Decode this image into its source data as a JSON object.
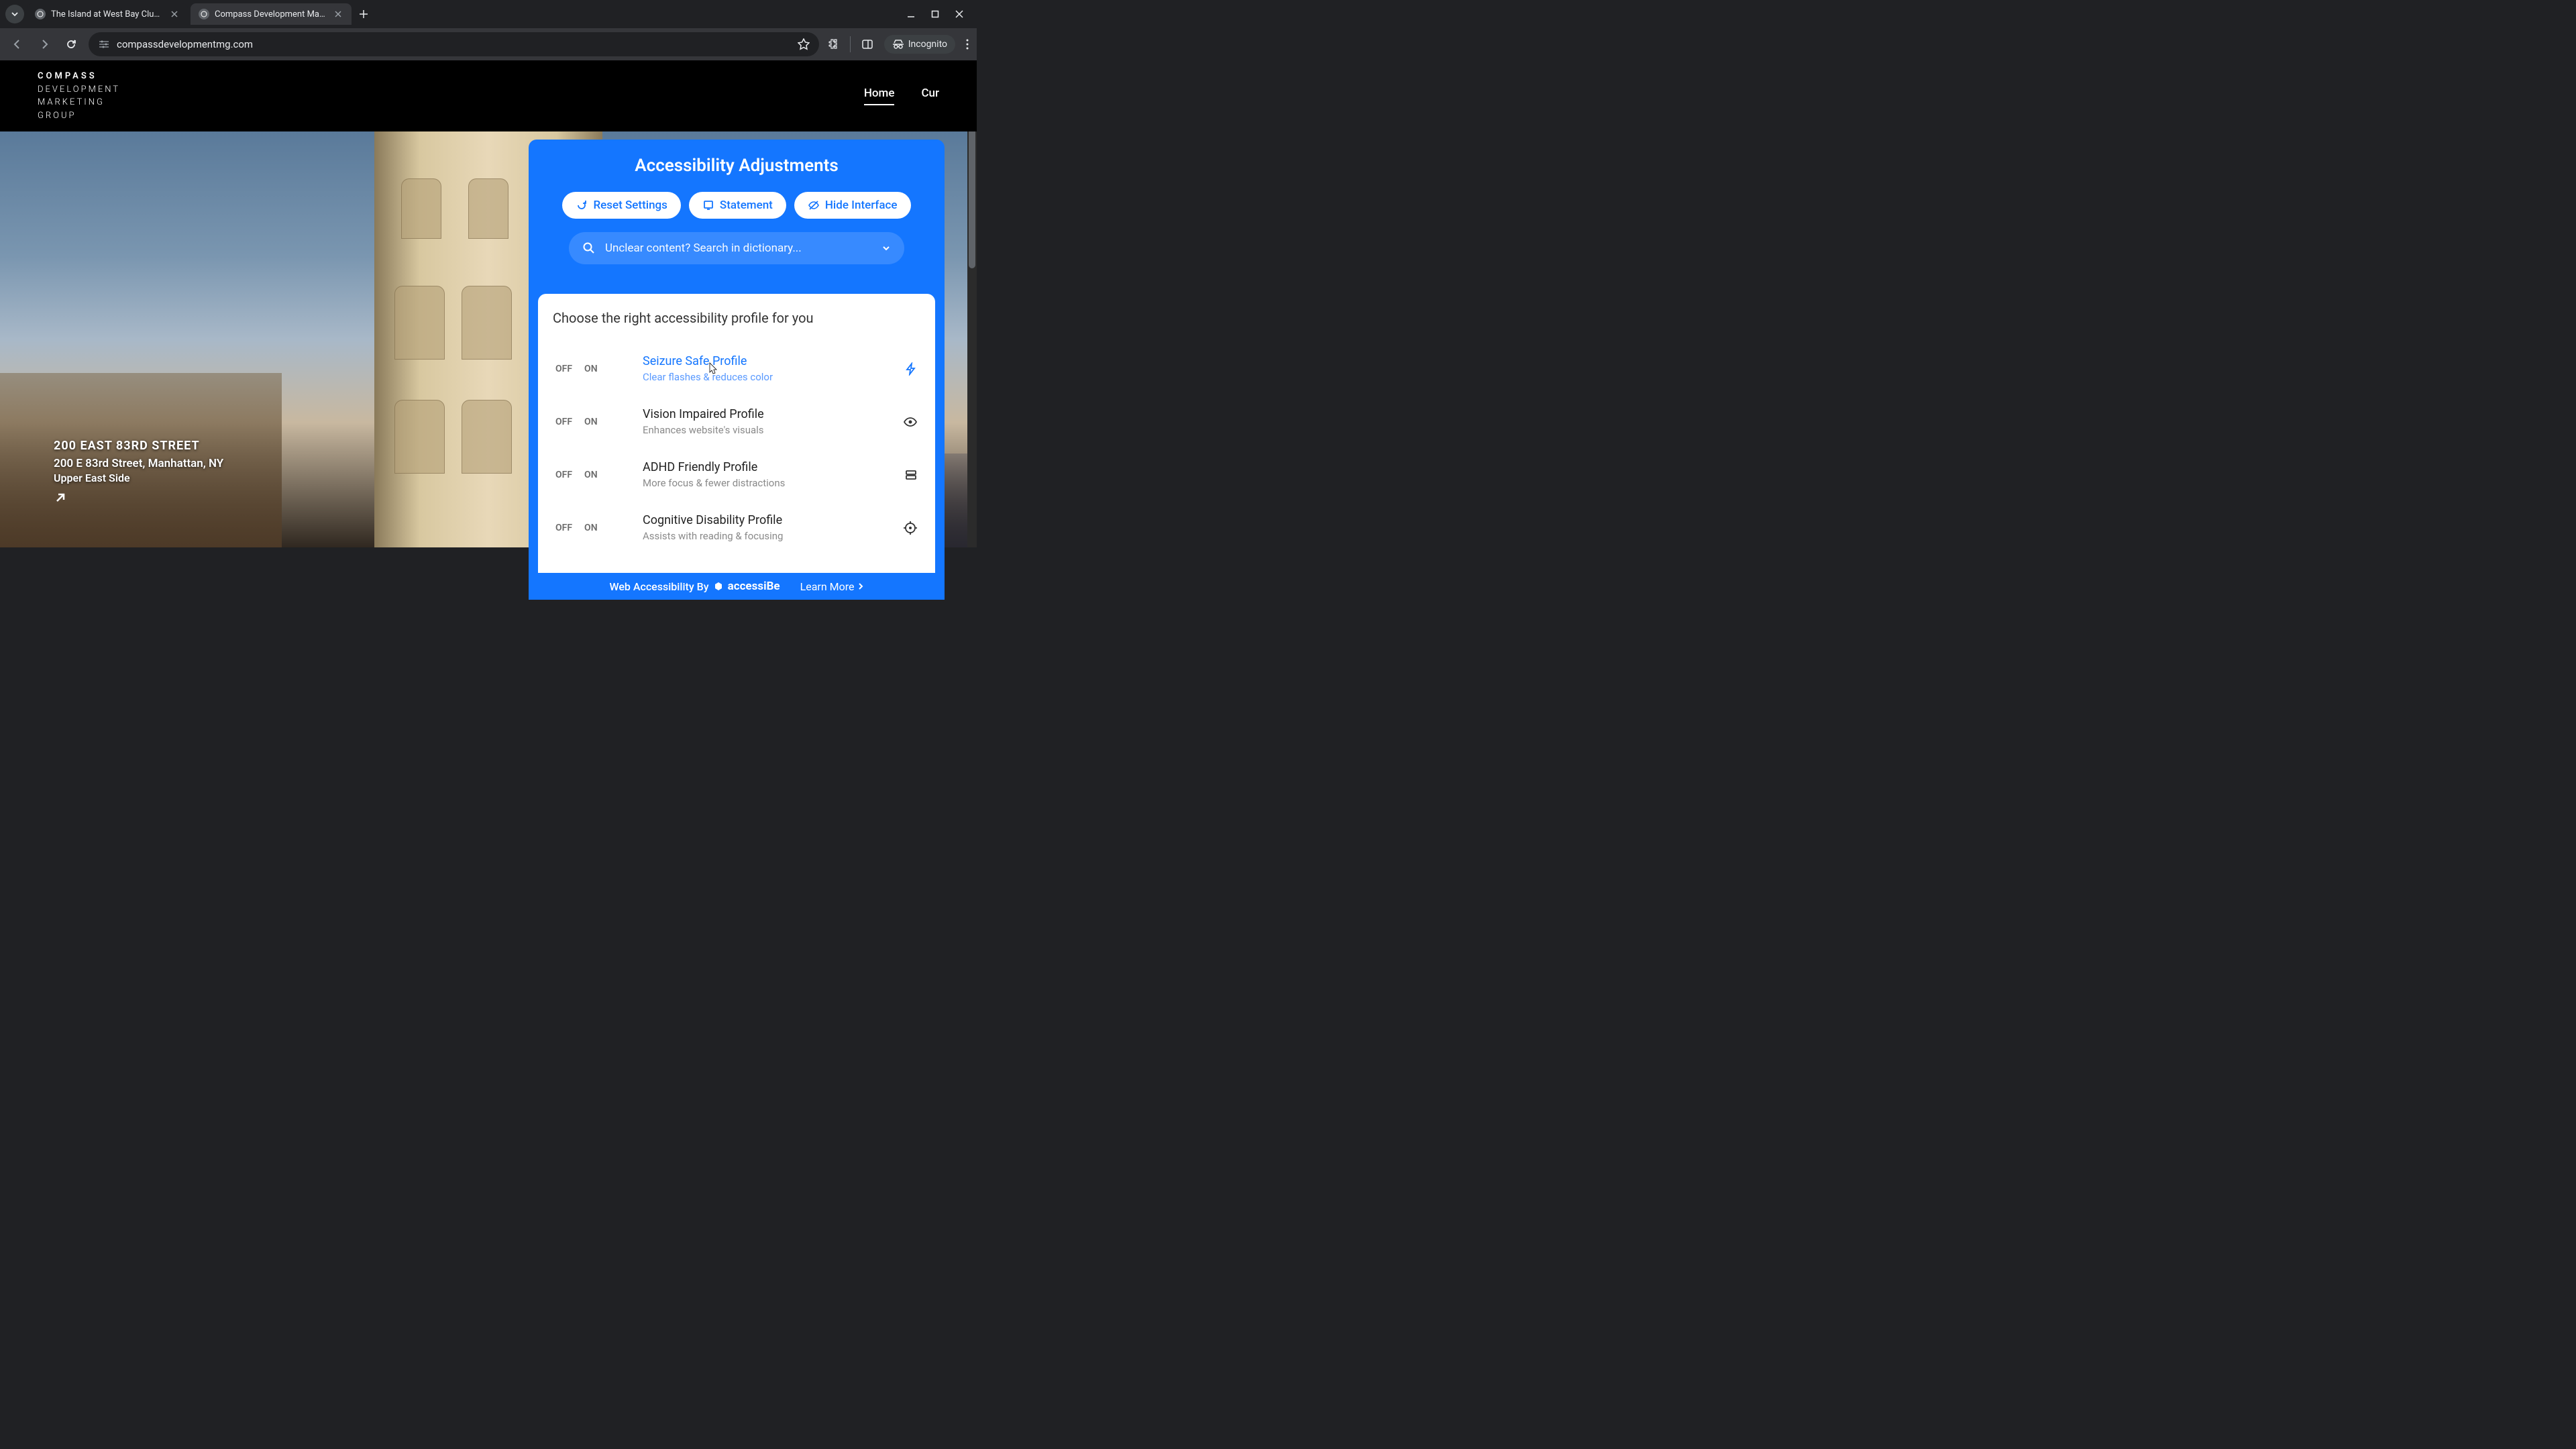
{
  "browser": {
    "tabs": [
      {
        "title": "The Island at West Bay Club at ",
        "active": false
      },
      {
        "title": "Compass Development Marketi",
        "active": true
      }
    ],
    "url": "compassdevelopmentmg.com",
    "incognito_label": "Incognito"
  },
  "site": {
    "logo_lines": [
      "COMPASS",
      "DEVELOPMENT",
      "MARKETING",
      "GROUP"
    ],
    "nav": {
      "home": "Home",
      "cur": "Cur"
    }
  },
  "hero": {
    "title": "200 EAST 83RD STREET",
    "address": "200 E 83rd Street, Manhattan, NY",
    "area": "Upper East Side"
  },
  "a11y": {
    "title": "Accessibility Adjustments",
    "buttons": {
      "reset": "Reset Settings",
      "statement": "Statement",
      "hide": "Hide Interface"
    },
    "search_placeholder": "Unclear content? Search in dictionary...",
    "section_heading": "Choose the right accessibility profile for you",
    "toggle": {
      "off": "OFF",
      "on": "ON"
    },
    "profiles": [
      {
        "name": "Seizure Safe Profile",
        "desc": "Clear flashes & reduces color"
      },
      {
        "name": "Vision Impaired Profile",
        "desc": "Enhances website's visuals"
      },
      {
        "name": "ADHD Friendly Profile",
        "desc": "More focus & fewer distractions"
      },
      {
        "name": "Cognitive Disability Profile",
        "desc": "Assists with reading & focusing"
      }
    ],
    "footer": {
      "by": "Web Accessibility By",
      "brand": "accessiBe",
      "learn": "Learn More"
    }
  }
}
